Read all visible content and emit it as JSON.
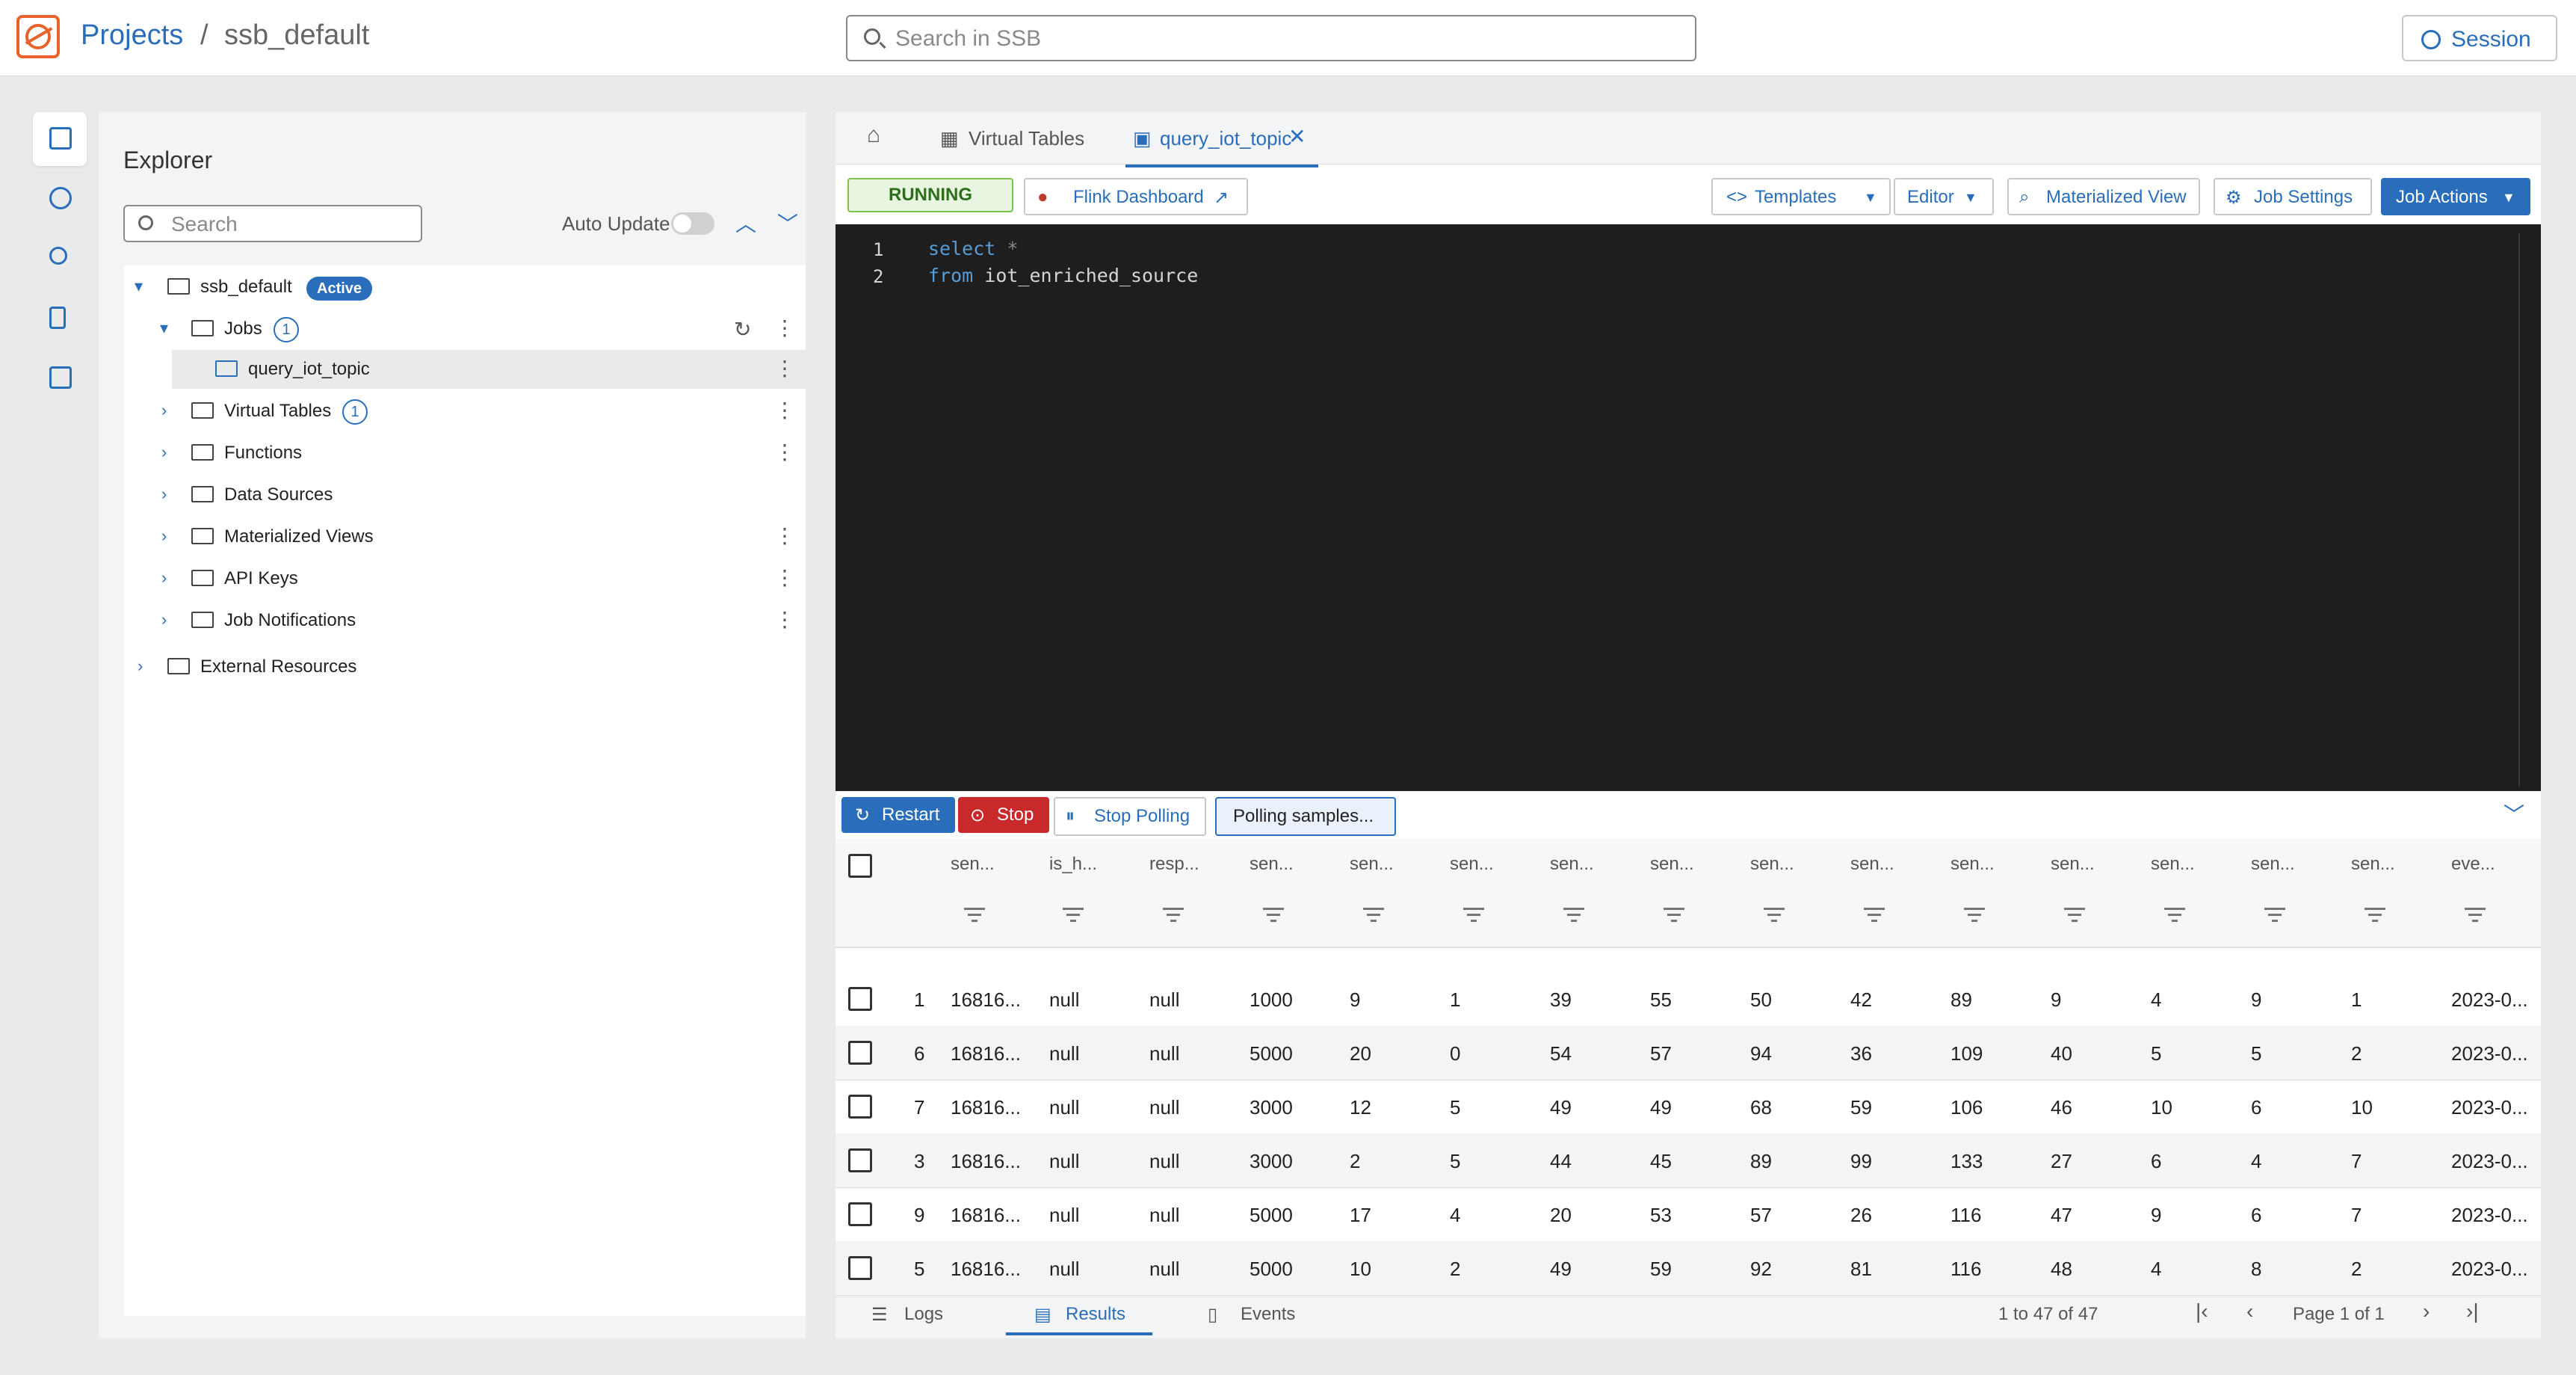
{
  "header": {
    "breadcrumb_root": "Projects",
    "breadcrumb_sep": "/",
    "breadcrumb_current": "ssb_default",
    "search_placeholder": "Search in SSB",
    "session_label": "Session"
  },
  "explorer": {
    "title": "Explorer",
    "search_placeholder": "Search",
    "auto_update_label": "Auto Update",
    "auto_update_on": false,
    "project": {
      "name": "ssb_default",
      "status": "Active"
    },
    "items": [
      {
        "label": "Jobs",
        "count": "1"
      },
      {
        "label": "query_iot_topic"
      },
      {
        "label": "Virtual Tables",
        "count": "1"
      },
      {
        "label": "Functions"
      },
      {
        "label": "Data Sources"
      },
      {
        "label": "Materialized Views"
      },
      {
        "label": "API Keys"
      },
      {
        "label": "Job Notifications"
      }
    ],
    "external": "External Resources"
  },
  "tabs": [
    {
      "label": "Virtual Tables"
    },
    {
      "label": "query_iot_topic"
    }
  ],
  "toolbar": {
    "status": "RUNNING",
    "flink_dashboard": "Flink Dashboard",
    "templates": "Templates",
    "editor": "Editor",
    "materialized_view": "Materialized View",
    "job_settings": "Job Settings",
    "job_actions": "Job Actions"
  },
  "editor": {
    "lines": [
      {
        "num": "1",
        "kw": "select",
        "rest": "*"
      },
      {
        "num": "2",
        "kw": "from",
        "rest": "iot_enriched_source"
      }
    ]
  },
  "results_toolbar": {
    "restart": "Restart",
    "stop": "Stop",
    "stop_polling": "Stop Polling",
    "polling_status": "Polling samples..."
  },
  "grid": {
    "columns": [
      "sen...",
      "is_h...",
      "resp...",
      "sen...",
      "sen...",
      "sen...",
      "sen...",
      "sen...",
      "sen...",
      "sen...",
      "sen...",
      "sen...",
      "sen...",
      "sen...",
      "sen...",
      "eve..."
    ],
    "rows": [
      [
        "1",
        "16816...",
        "null",
        "null",
        "1000",
        "9",
        "1",
        "39",
        "55",
        "50",
        "42",
        "89",
        "9",
        "4",
        "9",
        "1",
        "2023-0..."
      ],
      [
        "6",
        "16816...",
        "null",
        "null",
        "5000",
        "20",
        "0",
        "54",
        "57",
        "94",
        "36",
        "109",
        "40",
        "5",
        "5",
        "2",
        "2023-0..."
      ],
      [
        "7",
        "16816...",
        "null",
        "null",
        "3000",
        "12",
        "5",
        "49",
        "49",
        "68",
        "59",
        "106",
        "46",
        "10",
        "6",
        "10",
        "2023-0..."
      ],
      [
        "3",
        "16816...",
        "null",
        "null",
        "3000",
        "2",
        "5",
        "44",
        "45",
        "89",
        "99",
        "133",
        "27",
        "6",
        "4",
        "7",
        "2023-0..."
      ],
      [
        "9",
        "16816...",
        "null",
        "null",
        "5000",
        "17",
        "4",
        "20",
        "53",
        "57",
        "26",
        "116",
        "47",
        "9",
        "6",
        "7",
        "2023-0..."
      ],
      [
        "5",
        "16816...",
        "null",
        "null",
        "5000",
        "10",
        "2",
        "49",
        "59",
        "92",
        "81",
        "116",
        "48",
        "4",
        "8",
        "2",
        "2023-0..."
      ]
    ]
  },
  "bottom_tabs": {
    "logs": "Logs",
    "results": "Results",
    "events": "Events"
  },
  "pager": {
    "count": "1 to 47 of 47",
    "page": "Page 1 of 1"
  },
  "colors": {
    "accent": "#2a6ebb",
    "brand": "#e8622c",
    "running_bg": "#e8f5e0",
    "stop": "#c8292b",
    "editor_bg": "#1e1e1e"
  }
}
